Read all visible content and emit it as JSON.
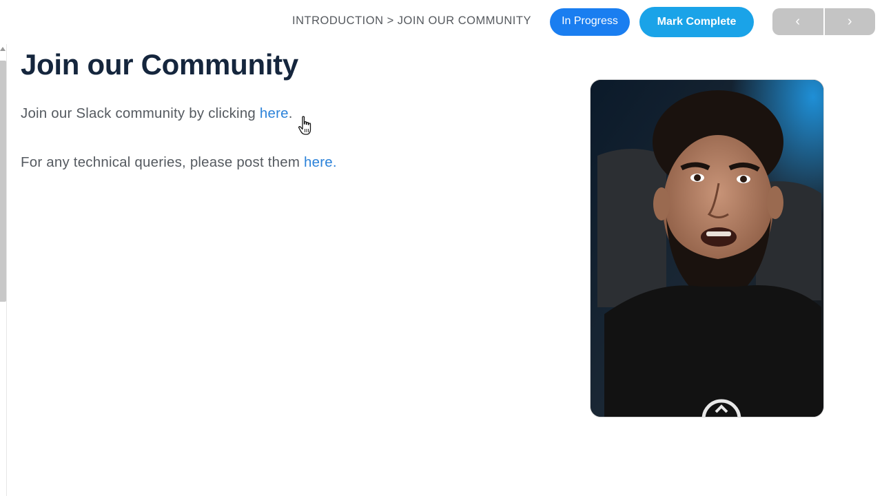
{
  "header": {
    "breadcrumb": "INTRODUCTION > JOIN OUR COMMUNITY",
    "status_label": "In Progress",
    "complete_label": "Mark Complete",
    "prev_label": "‹",
    "next_label": "›"
  },
  "main": {
    "title": "Join our Community",
    "slack_text": "Join our Slack community by clicking ",
    "slack_link": "here",
    "slack_suffix": ".",
    "queries_text": "For any technical queries, please post them ",
    "queries_link": "here."
  },
  "colors": {
    "status_pill": "#1a7ef0",
    "complete_button": "#1aa3e8",
    "link": "#2b82d9",
    "title": "#15263d"
  }
}
